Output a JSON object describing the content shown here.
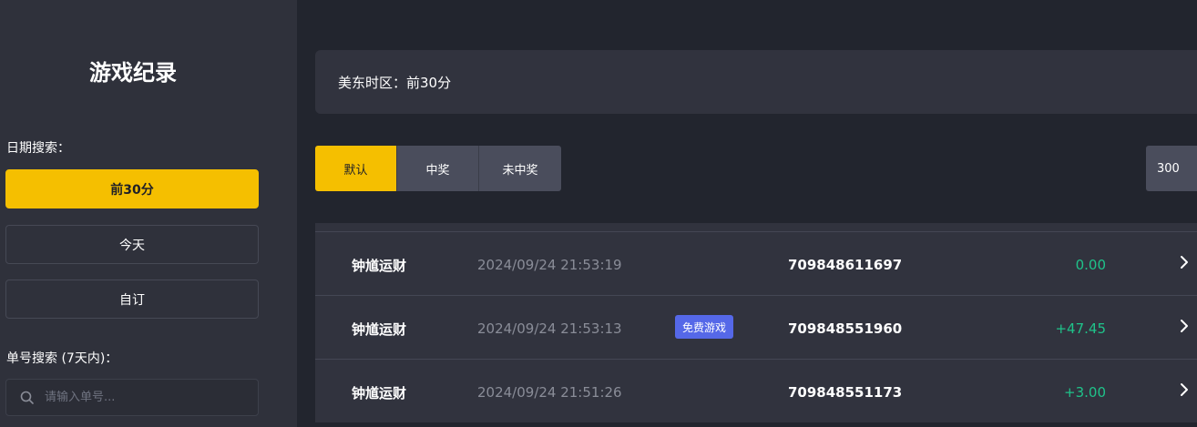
{
  "sidebar": {
    "title": "游戏纪录",
    "date_search_label": "日期搜索：",
    "date_options": [
      {
        "label": "前30分",
        "active": true
      },
      {
        "label": "今天",
        "active": false
      },
      {
        "label": "自订",
        "active": false
      }
    ],
    "order_search_label": "单号搜索 (7天内)：",
    "search": {
      "placeholder": "请输入单号...",
      "value": "",
      "icon": "search-icon"
    }
  },
  "main": {
    "timezone_text": "美东时区：前30分",
    "filters": [
      {
        "label": "默认",
        "active": true
      },
      {
        "label": "中奖",
        "active": false
      },
      {
        "label": "未中奖",
        "active": false
      }
    ],
    "page_size": "300",
    "records": [
      {
        "game": "钟馗运财",
        "time": "2024/09/24 21:53:19",
        "badge": "",
        "id": "709848611697",
        "amount": "0.00"
      },
      {
        "game": "钟馗运财",
        "time": "2024/09/24 21:53:13",
        "badge": "免费游戏",
        "id": "709848551960",
        "amount": "+47.45"
      },
      {
        "game": "钟馗运财",
        "time": "2024/09/24 21:51:26",
        "badge": "",
        "id": "709848551173",
        "amount": "+3.00"
      }
    ]
  },
  "colors": {
    "accent": "#f5bf00",
    "positive": "#1fc38a",
    "badge": "#5568e8",
    "background": "#22252e",
    "panel": "#31333e"
  }
}
